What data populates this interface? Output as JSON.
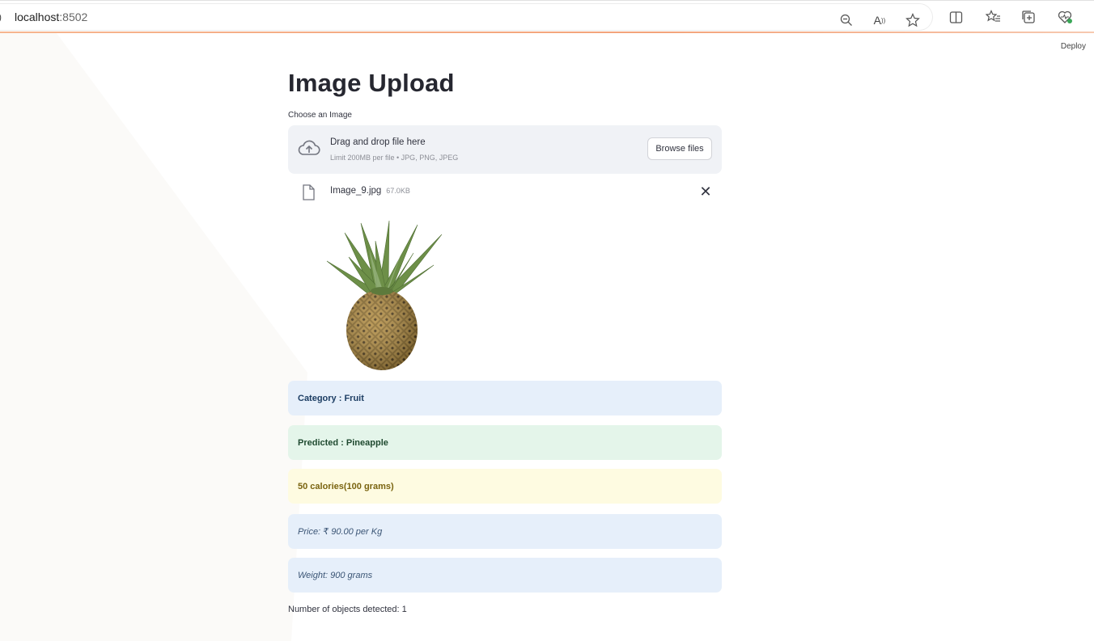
{
  "browser": {
    "url_host": "localhost",
    "url_port": ":8502",
    "icons": [
      "zoom-out-icon",
      "read-aloud-icon",
      "favorite-star-icon",
      "split-screen-icon",
      "favorites-list-icon",
      "collections-icon",
      "browser-essentials-icon"
    ]
  },
  "app": {
    "deploy_label": "Deploy",
    "title": "Image Upload"
  },
  "uploader": {
    "label": "Choose an Image",
    "drop_title": "Drag and drop file here",
    "drop_subtitle": "Limit 200MB per file • JPG, PNG, JPEG",
    "browse_button": "Browse files",
    "file": {
      "name": "Image_9.jpg",
      "size": "67.0KB"
    }
  },
  "results": {
    "category": "Category : Fruit",
    "predicted": "Predicted : Pineapple",
    "calories": "50 calories(100 grams)",
    "price": "Price: ₹ 90.00 per Kg",
    "weight": "Weight: 900 grams",
    "objects_detected": "Number of objects detected: 1"
  },
  "colors": {
    "info_bg": "#e6effa",
    "success_bg": "#e4f5ea",
    "warning_bg": "#fefbe1",
    "dropzone_bg": "#f0f2f6",
    "accent_line": "#f3a37a"
  }
}
